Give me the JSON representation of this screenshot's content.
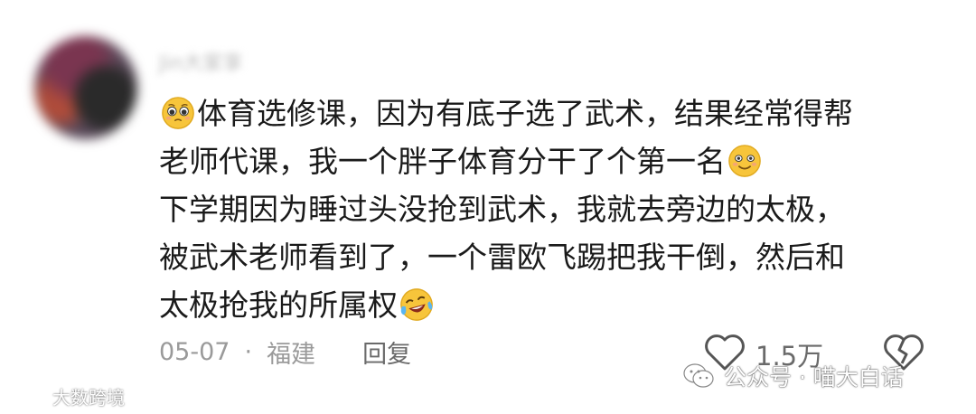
{
  "comment": {
    "username": "Jin大家享",
    "lines": [
      {
        "text": "体育选修课，因为有底子选了武术，结果经常得帮",
        "emoji_before": "pleading-face-emoji"
      },
      {
        "text": "老师代课，我一个胖子体育分干了个第一名",
        "emoji_after": "smiling-face-emoji"
      },
      {
        "text": "下学期因为睡过头没抢到武术，我就去旁边的太极，"
      },
      {
        "text": "被武术老师看到了，一个雷欧飞踢把我干倒，然后和"
      },
      {
        "text": "太极抢我的所属权",
        "emoji_after": "laughing-tears-emoji"
      }
    ],
    "date": "05-07",
    "separator": "·",
    "location": "福建",
    "reply_label": "回复",
    "like_count": "1.5万"
  },
  "watermarks": {
    "right": "公众号 · 喵大白话",
    "left": "大数跨境"
  },
  "icons": {
    "like": "heart-outline-icon",
    "dislike": "broken-heart-icon",
    "wechat": "wechat-icon",
    "logo": "dashujk-logo-icon"
  },
  "colors": {
    "text": "#1a1a1a",
    "meta": "#9a9a9a",
    "reply": "#6a6a6a",
    "emoji_yellow": "#f7c53b"
  }
}
